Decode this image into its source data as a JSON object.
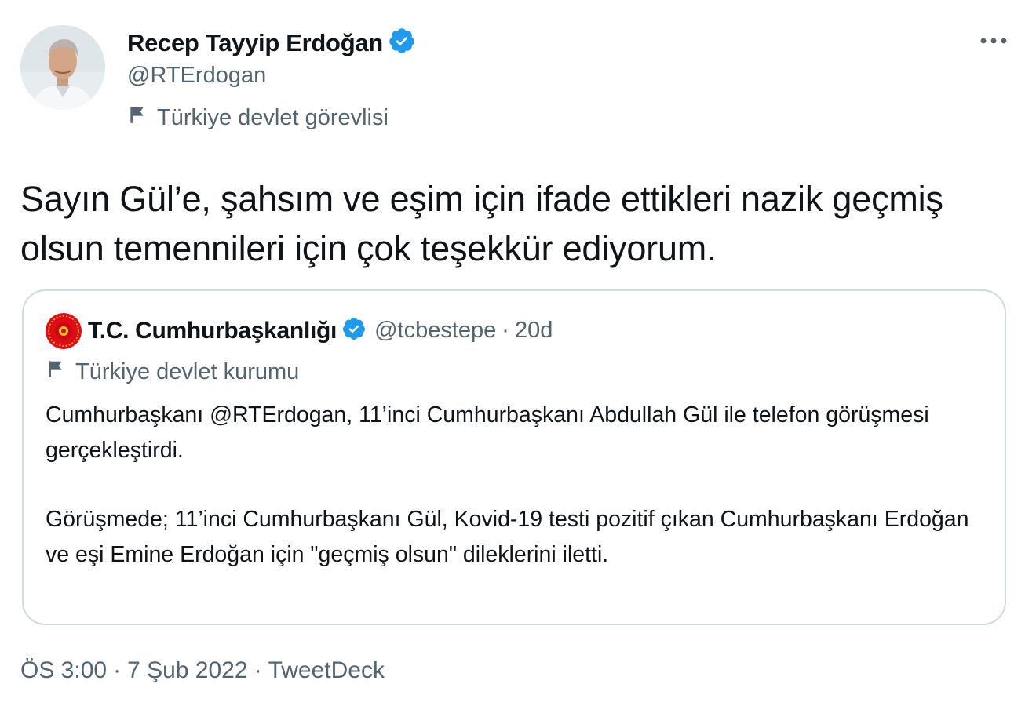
{
  "tweet": {
    "author": {
      "name": "Recep Tayyip Erdoğan",
      "handle": "@RTErdogan",
      "label": "Türkiye devlet görevlisi",
      "verified": true,
      "avatar_icon": "profile-photo"
    },
    "text": "Sayın Gül’e, şahsım ve eşim için ifade ettikleri nazik geçmiş olsun temennileri için çok teşekkür ediyorum.",
    "more_icon": "ellipsis-icon",
    "quote": {
      "name": "T.C. Cumhurbaşkanlığı",
      "handle": "@tcbestepe",
      "separator": "·",
      "time": "20d",
      "label": "Türkiye devlet kurumu",
      "verified": true,
      "avatar_icon": "presidential-seal",
      "paragraphs": [
        "Cumhurbaşkanı @RTErdogan, 11’inci Cumhurbaşkanı Abdullah Gül ile telefon görüşmesi gerçekleştirdi.",
        "Görüşmede; 11’inci Cumhurbaşkanı Gül, Kovid-19 testi pozitif çıkan Cumhurbaşkanı Erdoğan ve eşi Emine Erdoğan için \"geçmiş olsun\" dileklerini iletti."
      ]
    },
    "meta": {
      "time": "ÖS 3:00",
      "separator": "·",
      "date": "7 Şub 2022",
      "source": "TweetDeck"
    }
  },
  "colors": {
    "text_primary": "#0f1419",
    "text_secondary": "#536471",
    "verified_blue": "#1d9bf0",
    "border": "#cfd9de",
    "seal_red": "#e30a17"
  }
}
